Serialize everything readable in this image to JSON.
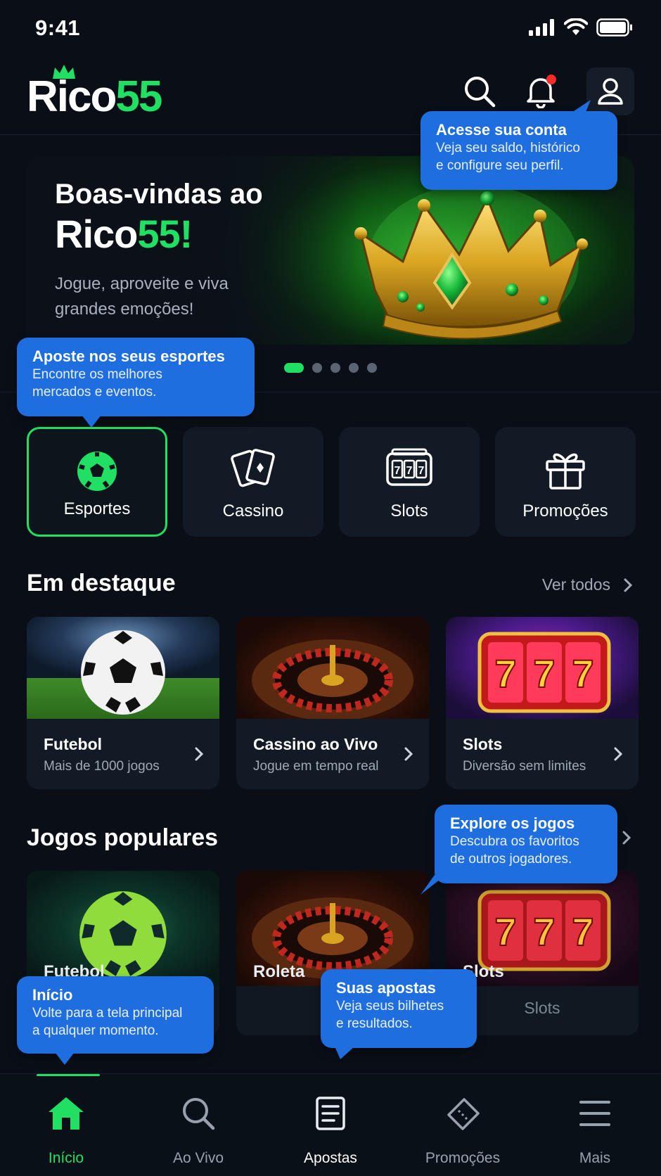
{
  "status_bar": {
    "time": "9:41"
  },
  "header": {
    "logo_main": "Rico",
    "logo_accent": "55",
    "icons": [
      "search-icon",
      "bell-icon",
      "user-icon"
    ],
    "notification_dot": true
  },
  "banner": {
    "line1": "Boas-vindas ao",
    "brand_main": "Rico",
    "brand_accent": "55!",
    "subtitle": "Jogue, aproveite e viva grandes emoções!",
    "slide_count": 5,
    "active_slide": 1
  },
  "categories": [
    {
      "label": "Esportes",
      "icon": "soccer-ball-icon",
      "active": true
    },
    {
      "label": "Cassino",
      "icon": "cards-icon",
      "active": false
    },
    {
      "label": "Slots",
      "icon": "slot-machine-icon",
      "active": false
    },
    {
      "label": "Promoções",
      "icon": "gift-icon",
      "active": false
    }
  ],
  "featured": {
    "title": "Em destaque",
    "see_all": "Ver todos",
    "cards": [
      {
        "title": "Futebol",
        "subtitle": "Mais de 1000 jogos"
      },
      {
        "title": "Cassino ao Vivo",
        "subtitle": "Jogue em tempo real"
      },
      {
        "title": "Slots",
        "subtitle": "Diversão sem limites"
      }
    ]
  },
  "popular": {
    "title": "Jogos populares",
    "cards": [
      {
        "label": "Futebol",
        "subtitle": ""
      },
      {
        "label": "Roleta",
        "subtitle": ""
      },
      {
        "label": "Slots",
        "subtitle": "Slots"
      }
    ]
  },
  "tooltips": {
    "account": {
      "title": "Acesse sua conta",
      "body": "Veja seu saldo, histórico\ne configure seu perfil."
    },
    "sports": {
      "title": "Aposte nos seus esportes",
      "body": "Encontre os melhores\nmercados e eventos."
    },
    "explore": {
      "title": "Explore os jogos",
      "body": "Descubra os favoritos\nde outros jogadores."
    },
    "home": {
      "title": "Início",
      "body": "Volte para a tela principal\na qualquer momento."
    },
    "bets": {
      "title": "Suas apostas",
      "body": "Veja seus bilhetes\ne resultados."
    }
  },
  "tabbar": [
    {
      "label": "Início",
      "icon": "home-icon",
      "active": true
    },
    {
      "label": "Ao Vivo",
      "icon": "search-icon",
      "active": false
    },
    {
      "label": "Apostas",
      "icon": "ticket-list-icon",
      "active": false
    },
    {
      "label": "Promoções",
      "icon": "coupon-icon",
      "active": false
    },
    {
      "label": "Mais",
      "icon": "menu-icon",
      "active": false
    }
  ],
  "colors": {
    "accent": "#1fe063",
    "background": "#0a0f17",
    "card": "#121a25",
    "tooltip": "#1e6ee0"
  }
}
